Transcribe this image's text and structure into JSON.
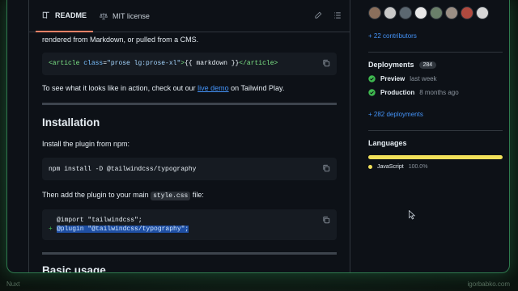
{
  "tabs": {
    "readme": "README",
    "license": "MIT license"
  },
  "readme": {
    "intro_line": "rendered from Markdown, or pulled from a CMS.",
    "code1": {
      "open_tag": "<article",
      "attr": "class",
      "eq": "=",
      "value": "\"prose lg:prose-xl\"",
      "close": ">",
      "content": "{{ markdown }}",
      "end_tag": "</article>"
    },
    "demo_prefix": "To see what it looks like in action, check out our ",
    "demo_link": "live demo",
    "demo_suffix": " on Tailwind Play.",
    "installation_heading": "Installation",
    "install_text": "Install the plugin from npm:",
    "install_code": "npm install -D @tailwindcss/typography",
    "then_prefix": "Then add the plugin to your main ",
    "then_code": "style.css",
    "then_suffix": " file:",
    "css_line1": "@import \"tailwindcss\";",
    "css_plus": "+",
    "css_line2": "@plugin \"@tailwindcss/typography\";",
    "basic_heading": "Basic usage"
  },
  "sidebar": {
    "contributors_link": "+ 22 contributors",
    "deployments_title": "Deployments",
    "deployments_count": "284",
    "deployments": [
      {
        "name": "Preview",
        "time": "last week"
      },
      {
        "name": "Production",
        "time": "8 months ago"
      }
    ],
    "deployments_link": "+ 282 deployments",
    "languages_title": "Languages",
    "language": {
      "name": "JavaScript",
      "percent": "100.0%",
      "color": "#f1e05a"
    }
  },
  "footer": {
    "left": "Nuxt",
    "right": "igorbabko.com"
  },
  "colors": {
    "accent_border": "#2f7a4e",
    "link": "#4493f8",
    "success": "#3fb950"
  },
  "avatar_colors": [
    "#8a6f5c",
    "#c9c9c9",
    "#5b6770",
    "#e8e8e8",
    "#6a7f6a",
    "#9b8f85",
    "#b04a3f",
    "#d6d6d6"
  ]
}
